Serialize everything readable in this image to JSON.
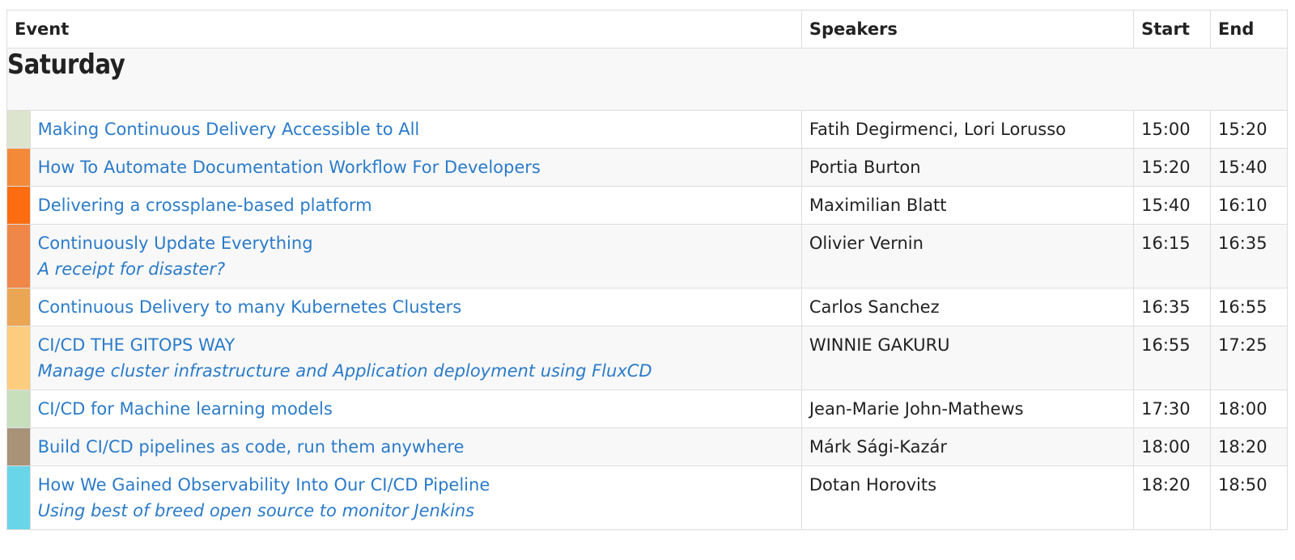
{
  "table": {
    "headers": {
      "event": "Event",
      "speakers": "Speakers",
      "start": "Start",
      "end": "End"
    },
    "day": "Saturday",
    "sessions": [
      {
        "color": "#dde4cd",
        "title": "Making Continuous Delivery Accessible to All",
        "subtitle": "",
        "speakers": "Fatih Degirmenci, Lori Lorusso",
        "start": "15:00",
        "end": "15:20"
      },
      {
        "color": "#f28a3a",
        "title": "How To Automate Documentation Workflow For Developers",
        "subtitle": "",
        "speakers": "Portia Burton",
        "start": "15:20",
        "end": "15:40"
      },
      {
        "color": "#fb6d10",
        "title": "Delivering a crossplane-based platform",
        "subtitle": "",
        "speakers": "Maximilian Blatt",
        "start": "15:40",
        "end": "16:10"
      },
      {
        "color": "#ef8748",
        "title": "Continuously Update Everything",
        "subtitle": "A receipt for disaster?",
        "speakers": "Olivier Vernin",
        "start": "16:15",
        "end": "16:35"
      },
      {
        "color": "#eba654",
        "title": "Continuous Delivery to many Kubernetes Clusters",
        "subtitle": "",
        "speakers": "Carlos Sanchez",
        "start": "16:35",
        "end": "16:55"
      },
      {
        "color": "#fdcd7f",
        "title": "CI/CD THE GITOPS WAY",
        "subtitle": "Manage cluster infrastructure and Application deployment using FluxCD",
        "speakers": "WINNIE GAKURU",
        "start": "16:55",
        "end": "17:25"
      },
      {
        "color": "#c7dfbd",
        "title": "CI/CD for Machine learning models",
        "subtitle": "",
        "speakers": "Jean-Marie John-Mathews",
        "start": "17:30",
        "end": "18:00"
      },
      {
        "color": "#a89278",
        "title": "Build CI/CD pipelines as code, run them anywhere",
        "subtitle": "",
        "speakers": "Márk Sági-Kazár",
        "start": "18:00",
        "end": "18:20"
      },
      {
        "color": "#69d5e8",
        "title": "How We Gained Observability Into Our CI/CD Pipeline",
        "subtitle": "Using best of breed open source to monitor Jenkins",
        "speakers": "Dotan Horovits",
        "start": "18:20",
        "end": "18:50"
      }
    ]
  }
}
